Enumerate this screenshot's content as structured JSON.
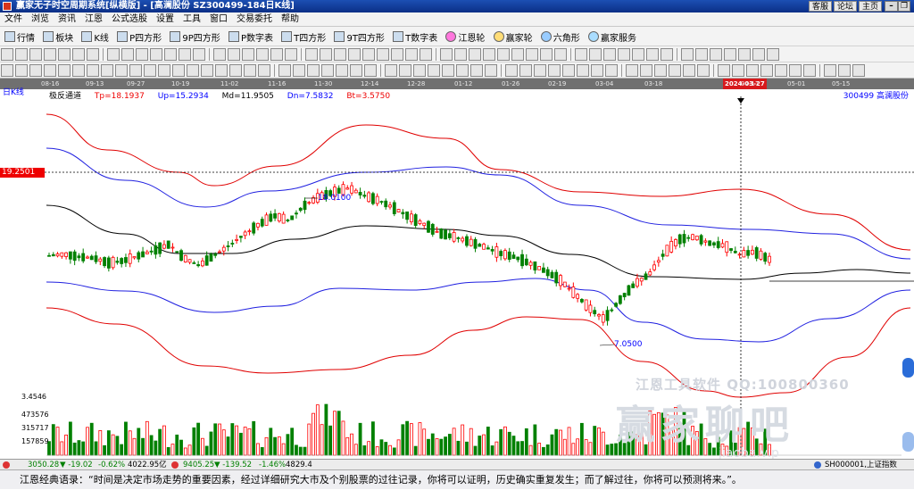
{
  "window": {
    "title": "赢家无子时空周期系统[纵横版] - [高澜股份  SZ300499-184日K线]",
    "links": [
      "客服",
      "论坛",
      "主页"
    ],
    "controls": [
      "–",
      "❐",
      "×"
    ]
  },
  "menu": [
    "文件",
    "浏览",
    "资讯",
    "江恩",
    "公式选股",
    "设置",
    "工具",
    "窗口",
    "交易委托",
    "帮助"
  ],
  "toolbar1": [
    "行情",
    "板块",
    "K线",
    "P四方形",
    "9P四方形",
    "P数字表",
    "T四方形",
    "9T四方形",
    "T数字表",
    "江恩轮",
    "赢家轮",
    "六角形",
    "赢家服务"
  ],
  "date_ruler": {
    "ticks": [
      "08-16",
      "09-13",
      "09-27",
      "10-19",
      "11-02",
      "11-16",
      "11-30",
      "12-14",
      "12-28",
      "01-12",
      "01-26",
      "02-19",
      "03-04",
      "03-18",
      "2024-03-27",
      "04-17",
      "05-01",
      "05-15"
    ],
    "highlight": "2024-03-27"
  },
  "chart_header": {
    "period": "日K线",
    "indicator": "极反通道",
    "tp": "Tp=18.1937",
    "up": "Up=15.2934",
    "md": "Md=11.9505",
    "dn": "Dn=7.5832",
    "bt": "Bt=3.5750",
    "stock": "300499  高澜股份"
  },
  "price_labels": {
    "cursor_price": "19.2501",
    "high_mark": "18.0100",
    "low_mark": "7.0500"
  },
  "volume_labels": [
    "3.4546",
    "473576",
    "315717",
    "157859"
  ],
  "watermark": {
    "line1": "江恩工具软件  QQ:100800360",
    "line2": "赢家聊吧",
    "line3": "jiaoba.vip"
  },
  "statusbar": {
    "index1": "3050.28",
    "index1_change": "▼ -19.02",
    "index1_pct": "-0.62%",
    "index1_amount": "4022.95亿",
    "index2": "9405.25",
    "index2_change": "▼ -139.52",
    "index2_pct": "-1.46%",
    "index2_amount": "4829.4",
    "right": "SH000001,上证指数"
  },
  "quote": "江恩经典语录：“时间是决定市场走势的重要因素，经过详细研究大市及个别股票的过往记录，你将可以证明，历史确实重复发生；而了解过往，你将可以预测将来。”。",
  "colors": {
    "up": "#ff0000",
    "down": "#008000",
    "outer_band": "#e00000",
    "inner_band": "#2020e0",
    "mid_line": "#000000"
  },
  "chart_data": {
    "type": "candlestick",
    "title": "高澜股份 SZ300499 日K线 极反通道",
    "channel": {
      "Tp": 18.1937,
      "Up": 15.2934,
      "Md": 11.9505,
      "Dn": 7.5832,
      "Bt": 3.575
    },
    "marked_high": 18.01,
    "marked_low": 7.05,
    "cursor_price": 19.2501,
    "cursor_date": "2024-03-27",
    "x_ticks": [
      "08-16",
      "09-13",
      "09-27",
      "10-19",
      "11-02",
      "11-16",
      "11-30",
      "12-14",
      "12-28",
      "01-12",
      "01-26",
      "02-19",
      "03-04",
      "03-18",
      "2024-03-27",
      "04-17",
      "05-01",
      "05-15"
    ],
    "close_path": [
      12.4,
      12.5,
      12.3,
      12.2,
      11.8,
      12.0,
      12.4,
      12.8,
      13.3,
      12.2,
      11.6,
      12.4,
      13.2,
      14.1,
      14.9,
      15.6,
      15.2,
      16.4,
      17.1,
      17.5,
      17.8,
      17.2,
      16.8,
      16.2,
      15.5,
      14.9,
      14.2,
      13.9,
      13.5,
      13.1,
      12.6,
      12.3,
      11.8,
      11.2,
      10.5,
      9.4,
      8.2,
      7.3,
      8.8,
      10.1,
      10.9,
      12.6,
      13.7,
      13.9,
      13.4,
      13.2,
      12.5,
      12.7,
      12.1
    ],
    "volume_axis": [
      3.4546,
      473576,
      315717,
      157859
    ]
  }
}
